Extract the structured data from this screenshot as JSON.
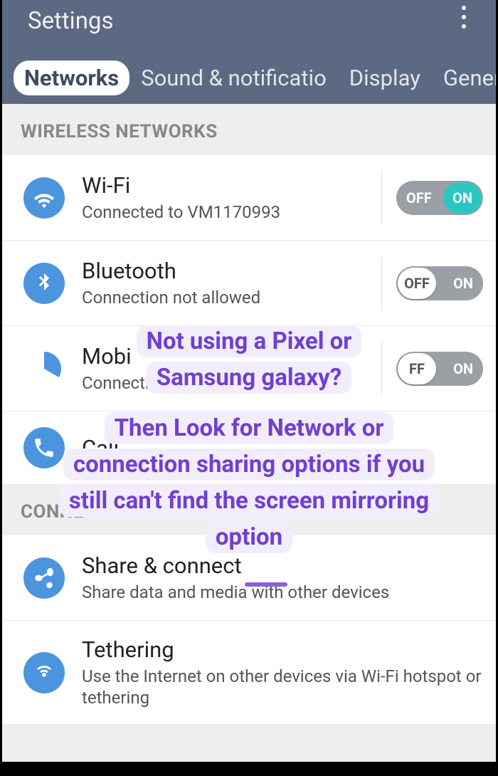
{
  "header": {
    "title": "Settings",
    "tabs": [
      "Networks",
      "Sound & notificatio",
      "Display",
      "General"
    ],
    "activeTab": 0
  },
  "sections": {
    "wireless": {
      "label": "WIRELESS NETWORKS",
      "items": [
        {
          "title": "Wi-Fi",
          "sub": "Connected to VM1170993",
          "toggle": "on"
        },
        {
          "title": "Bluetooth",
          "sub": "Connection not allowed",
          "toggle": "off"
        },
        {
          "title": "Mobi",
          "sub": "Connection not allowed",
          "toggle": "off_partial"
        },
        {
          "title": "Call",
          "sub": ""
        }
      ]
    },
    "connectivity": {
      "label": "CONNE",
      "items": [
        {
          "title": "Share & connect",
          "sub": "Share data and media with other devices"
        },
        {
          "title": "Tethering",
          "sub": "Use the Internet on other devices via Wi-Fi hotspot or tethering"
        }
      ]
    }
  },
  "toggleLabels": {
    "off": "OFF",
    "on": "ON",
    "offPartial": "FF"
  },
  "overlay": {
    "line1": "Not using a Pixel or Samsung galaxy?",
    "line2": "Then Look for Network or connection sharing options if you still can't find the screen mirroring option"
  }
}
